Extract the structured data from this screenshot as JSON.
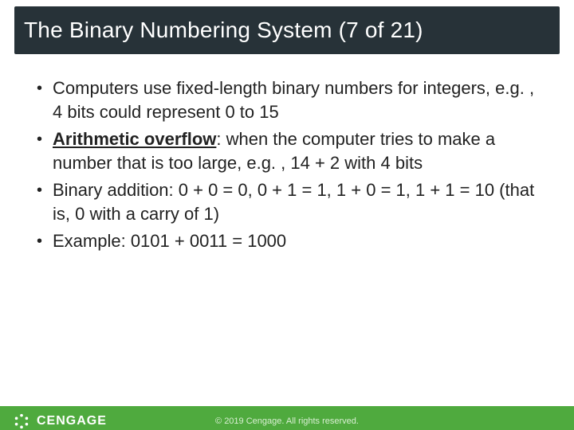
{
  "title": "The Binary Numbering System (7 of 21)",
  "bullets": [
    {
      "prefix": "",
      "plain": "Computers use fixed-length binary numbers for integers, e.g. , 4 bits could represent 0 to 15"
    },
    {
      "prefix": "Arithmetic overflow",
      "plain": ": when the computer tries to make a number that is too large, e.g. , 14 + 2 with 4 bits"
    },
    {
      "prefix": "",
      "plain": "Binary addition: 0 + 0 = 0, 0 + 1 = 1, 1 + 0 = 1, 1 + 1 = 10 (that is, 0 with a carry of 1)"
    },
    {
      "prefix": "",
      "plain": "Example:  0101 + 0011  = 1000"
    }
  ],
  "footer": {
    "brand": "CENGAGE",
    "copyright": "© 2019 Cengage. All rights reserved."
  }
}
